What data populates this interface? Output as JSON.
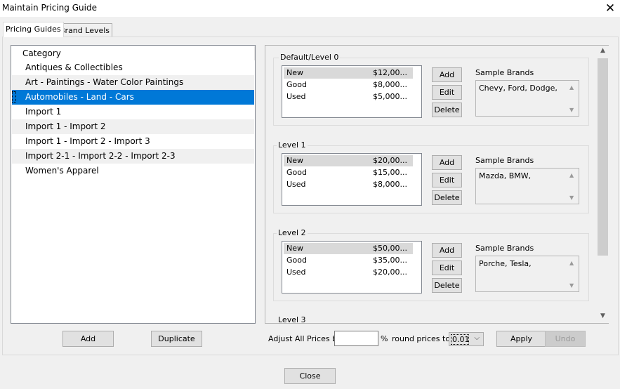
{
  "window": {
    "title": "Maintain Pricing Guide",
    "close_glyph": "✕"
  },
  "tabs": [
    {
      "label": "Pricing Guides",
      "active": true
    },
    {
      "label": "Brand Levels",
      "active": false
    }
  ],
  "category_list": {
    "header": "Category",
    "items": [
      "Antiques & Collectibles",
      "Art - Paintings - Water Color Paintings",
      "Automobiles - Land - Cars",
      "Import 1",
      "Import 1 - Import 2",
      "Import 1 - Import 2 - Import 3",
      "Import 2-1 - Import 2-2 - Import 2-3",
      "Women's Apparel"
    ],
    "selected_index": 2,
    "selection_color": "#0078d7"
  },
  "levels": [
    {
      "title": "Default/Level 0",
      "rows": [
        {
          "name": "New",
          "price": "$12,00..."
        },
        {
          "name": "Good",
          "price": "$8,000..."
        },
        {
          "name": "Used",
          "price": "$5,000..."
        }
      ],
      "sample_brands_label": "Sample Brands",
      "sample_brands": "Chevy, Ford, Dodge,"
    },
    {
      "title": "Level 1",
      "rows": [
        {
          "name": "New",
          "price": "$20,00..."
        },
        {
          "name": "Good",
          "price": "$15,00..."
        },
        {
          "name": "Used",
          "price": "$8,000..."
        }
      ],
      "sample_brands_label": "Sample Brands",
      "sample_brands": "Mazda, BMW,"
    },
    {
      "title": "Level 2",
      "rows": [
        {
          "name": "New",
          "price": "$50,00..."
        },
        {
          "name": "Good",
          "price": "$35,00..."
        },
        {
          "name": "Used",
          "price": "$20,00..."
        }
      ],
      "sample_brands_label": "Sample Brands",
      "sample_brands": "Porche, Tesla,"
    },
    {
      "title": "Level 3"
    }
  ],
  "level_buttons": {
    "add": "Add",
    "edit": "Edit",
    "delete": "Delete"
  },
  "bottom_left": {
    "add": "Add",
    "duplicate": "Duplicate"
  },
  "adjust": {
    "label": "Adjust All Prices by",
    "value": "",
    "percent": "%",
    "round_label": "round prices to",
    "round_value": "0.01",
    "apply": "Apply",
    "undo": "Undo"
  },
  "footer": {
    "close": "Close"
  },
  "icons": {
    "scroll_up": "chevron-up-icon",
    "scroll_down": "chevron-down-icon",
    "dropdown": "chevron-down-icon"
  }
}
